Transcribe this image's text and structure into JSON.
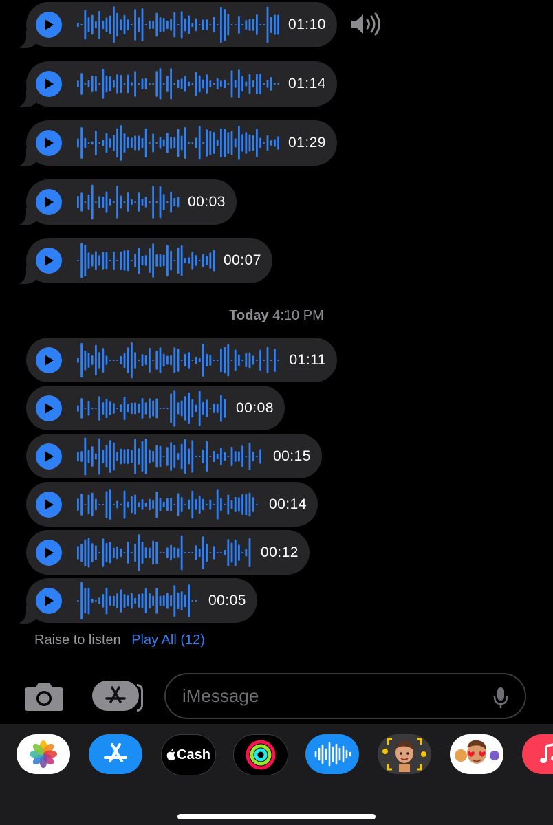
{
  "messages_before": [
    {
      "duration": "01:10"
    },
    {
      "duration": "01:14"
    },
    {
      "duration": "01:29"
    },
    {
      "duration": "00:03"
    },
    {
      "duration": "00:07"
    }
  ],
  "timestamp": {
    "day": "Today",
    "time": "4:10 PM"
  },
  "messages_after": [
    {
      "duration": "01:11"
    },
    {
      "duration": "00:08"
    },
    {
      "duration": "00:15"
    },
    {
      "duration": "00:14"
    },
    {
      "duration": "00:12"
    },
    {
      "duration": "00:05"
    }
  ],
  "footer": {
    "raise_to_listen": "Raise to listen",
    "play_all": "Play All (12)"
  },
  "compose": {
    "placeholder": "iMessage"
  },
  "app_tray": {
    "cash_label": "Cash",
    "icons": [
      "photos-app-icon",
      "app-store-app-icon",
      "apple-cash-app-icon",
      "activity-app-icon",
      "audio-message-app-icon",
      "memoji-app-icon",
      "memoji-stickers-app-icon",
      "music-app-icon"
    ]
  },
  "colors": {
    "accent": "#2f7ff5",
    "bubble": "#262629",
    "background": "#000000",
    "tray": "#1c1c1e"
  }
}
